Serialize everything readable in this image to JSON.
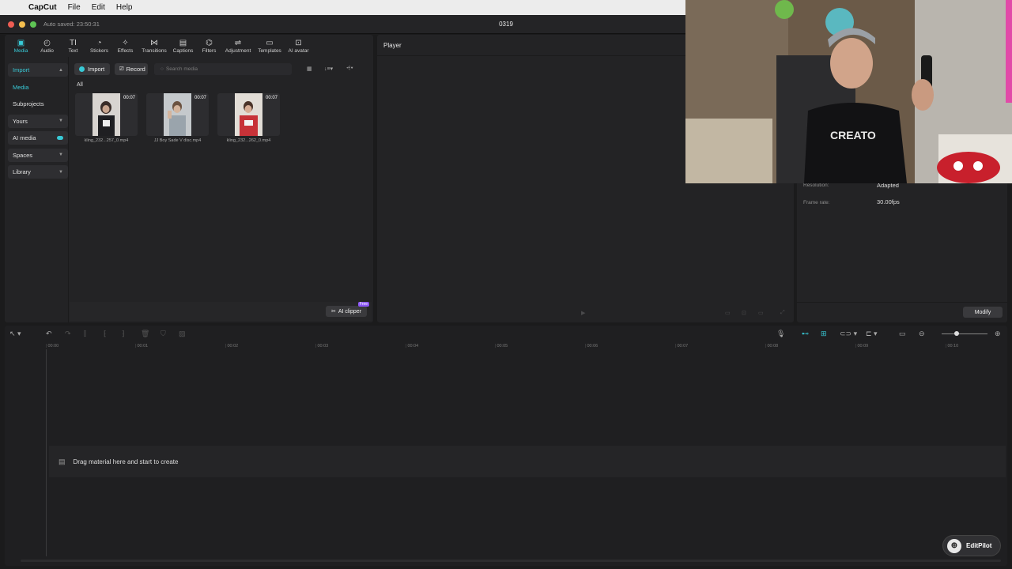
{
  "menubar": {
    "apple": "",
    "app": "CapCut",
    "items": [
      "File",
      "Edit",
      "Help"
    ]
  },
  "window": {
    "autosave": "Auto saved: 23:50:31",
    "title": "0319"
  },
  "toolbar": [
    {
      "label": "Media",
      "icon": "▣"
    },
    {
      "label": "Audio",
      "icon": "◴"
    },
    {
      "label": "Text",
      "icon": "TI"
    },
    {
      "label": "Stickers",
      "icon": "◔"
    },
    {
      "label": "Effects",
      "icon": "✧"
    },
    {
      "label": "Transitions",
      "icon": "⋈"
    },
    {
      "label": "Captions",
      "icon": "▤"
    },
    {
      "label": "Filters",
      "icon": "⌬"
    },
    {
      "label": "Adjustment",
      "icon": "⇌"
    },
    {
      "label": "Templates",
      "icon": "▭"
    },
    {
      "label": "AI avatar",
      "icon": "⊡"
    }
  ],
  "sidenav": {
    "import": "Import",
    "media": "Media",
    "subprojects": "Subprojects",
    "yours": "Yours",
    "ai_media": "AI media",
    "spaces": "Spaces",
    "library": "Library"
  },
  "media": {
    "import_btn": "Import",
    "record_btn": "Record",
    "search_placeholder": "Search media",
    "all_label": "All",
    "clips": [
      {
        "name": "kling_232...257_0.mp4",
        "duration": "00:07"
      },
      {
        "name": "JJ Boy Sade V disc.mp4",
        "duration": "00:07"
      },
      {
        "name": "kling_232...262_0.mp4",
        "duration": "00:07"
      }
    ],
    "ai_clipper": "AI clipper",
    "free_tag": "Free"
  },
  "player": {
    "title": "Player"
  },
  "details": {
    "resolution_label": "Resolution:",
    "resolution_value": "Adapted",
    "framerate_label": "Frame rate:",
    "framerate_value": "30.00fps",
    "modify_btn": "Modify"
  },
  "timeline": {
    "ticks": [
      "00:00",
      "00:01",
      "00:02",
      "00:03",
      "00:04",
      "00:05",
      "00:06",
      "00:07",
      "00:08",
      "00:09",
      "00:10"
    ],
    "drop_text": "Drag material here and start to create"
  },
  "editpilot": {
    "label": "EditPilot"
  },
  "webcam": {
    "shirt_text": "CREATO"
  },
  "colors": {
    "accent": "#38c9d6",
    "bg": "#1b1b1c",
    "panel": "#232325"
  }
}
